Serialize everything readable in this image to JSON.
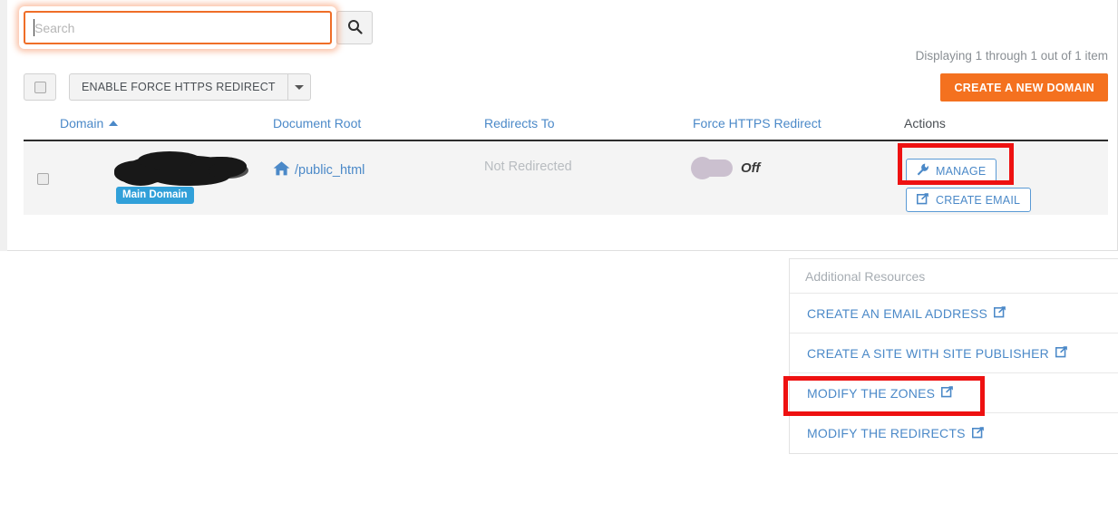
{
  "search": {
    "placeholder": "Search",
    "value": "",
    "button_icon": "search-icon"
  },
  "summary": {
    "displaying": "Displaying 1 through 1 out of 1 item"
  },
  "toolbar": {
    "select_all_checkbox": "",
    "bulk_action_label": "ENABLE FORCE HTTPS REDIRECT",
    "bulk_caret_icon": "chevron-down-icon",
    "create_domain_label": "CREATE A NEW DOMAIN"
  },
  "table": {
    "headers": {
      "domain": "Domain",
      "document_root": "Document Root",
      "redirects_to": "Redirects To",
      "force_https_redirect": "Force HTTPS Redirect",
      "actions": "Actions"
    },
    "sort": {
      "column": "Domain",
      "direction": "asc",
      "icon": "caret-up-icon"
    },
    "rows": [
      {
        "domain": "",
        "domain_redacted": true,
        "badge": "Main Domain",
        "document_root": "/public_html",
        "document_root_icon": "home-icon",
        "redirects_to": "Not Redirected",
        "force_https_redirect": "Off",
        "force_https_state": "off",
        "actions": [
          {
            "label": "MANAGE",
            "icon": "wrench-icon"
          },
          {
            "label": "CREATE EMAIL",
            "icon": "external-link-icon"
          }
        ]
      }
    ]
  },
  "resources": {
    "title": "Additional Resources",
    "items": [
      {
        "label": "CREATE AN EMAIL ADDRESS",
        "icon": "external-link-icon"
      },
      {
        "label": "CREATE A SITE WITH SITE PUBLISHER",
        "icon": "external-link-icon"
      },
      {
        "label": "MODIFY THE ZONES",
        "icon": "external-link-icon"
      },
      {
        "label": "MODIFY THE REDIRECTS",
        "icon": "external-link-icon"
      }
    ]
  },
  "annotations": [
    {
      "target": "MANAGE",
      "color": "#ee1111"
    },
    {
      "target": "MODIFY THE ZONES",
      "color": "#ee1111"
    }
  ],
  "colors": {
    "accent_orange": "#f4711f",
    "link_blue": "#4b89c8",
    "badge_blue": "#31a0d9",
    "annotation_red": "#ee1111",
    "row_bg": "#f4f4f4"
  }
}
